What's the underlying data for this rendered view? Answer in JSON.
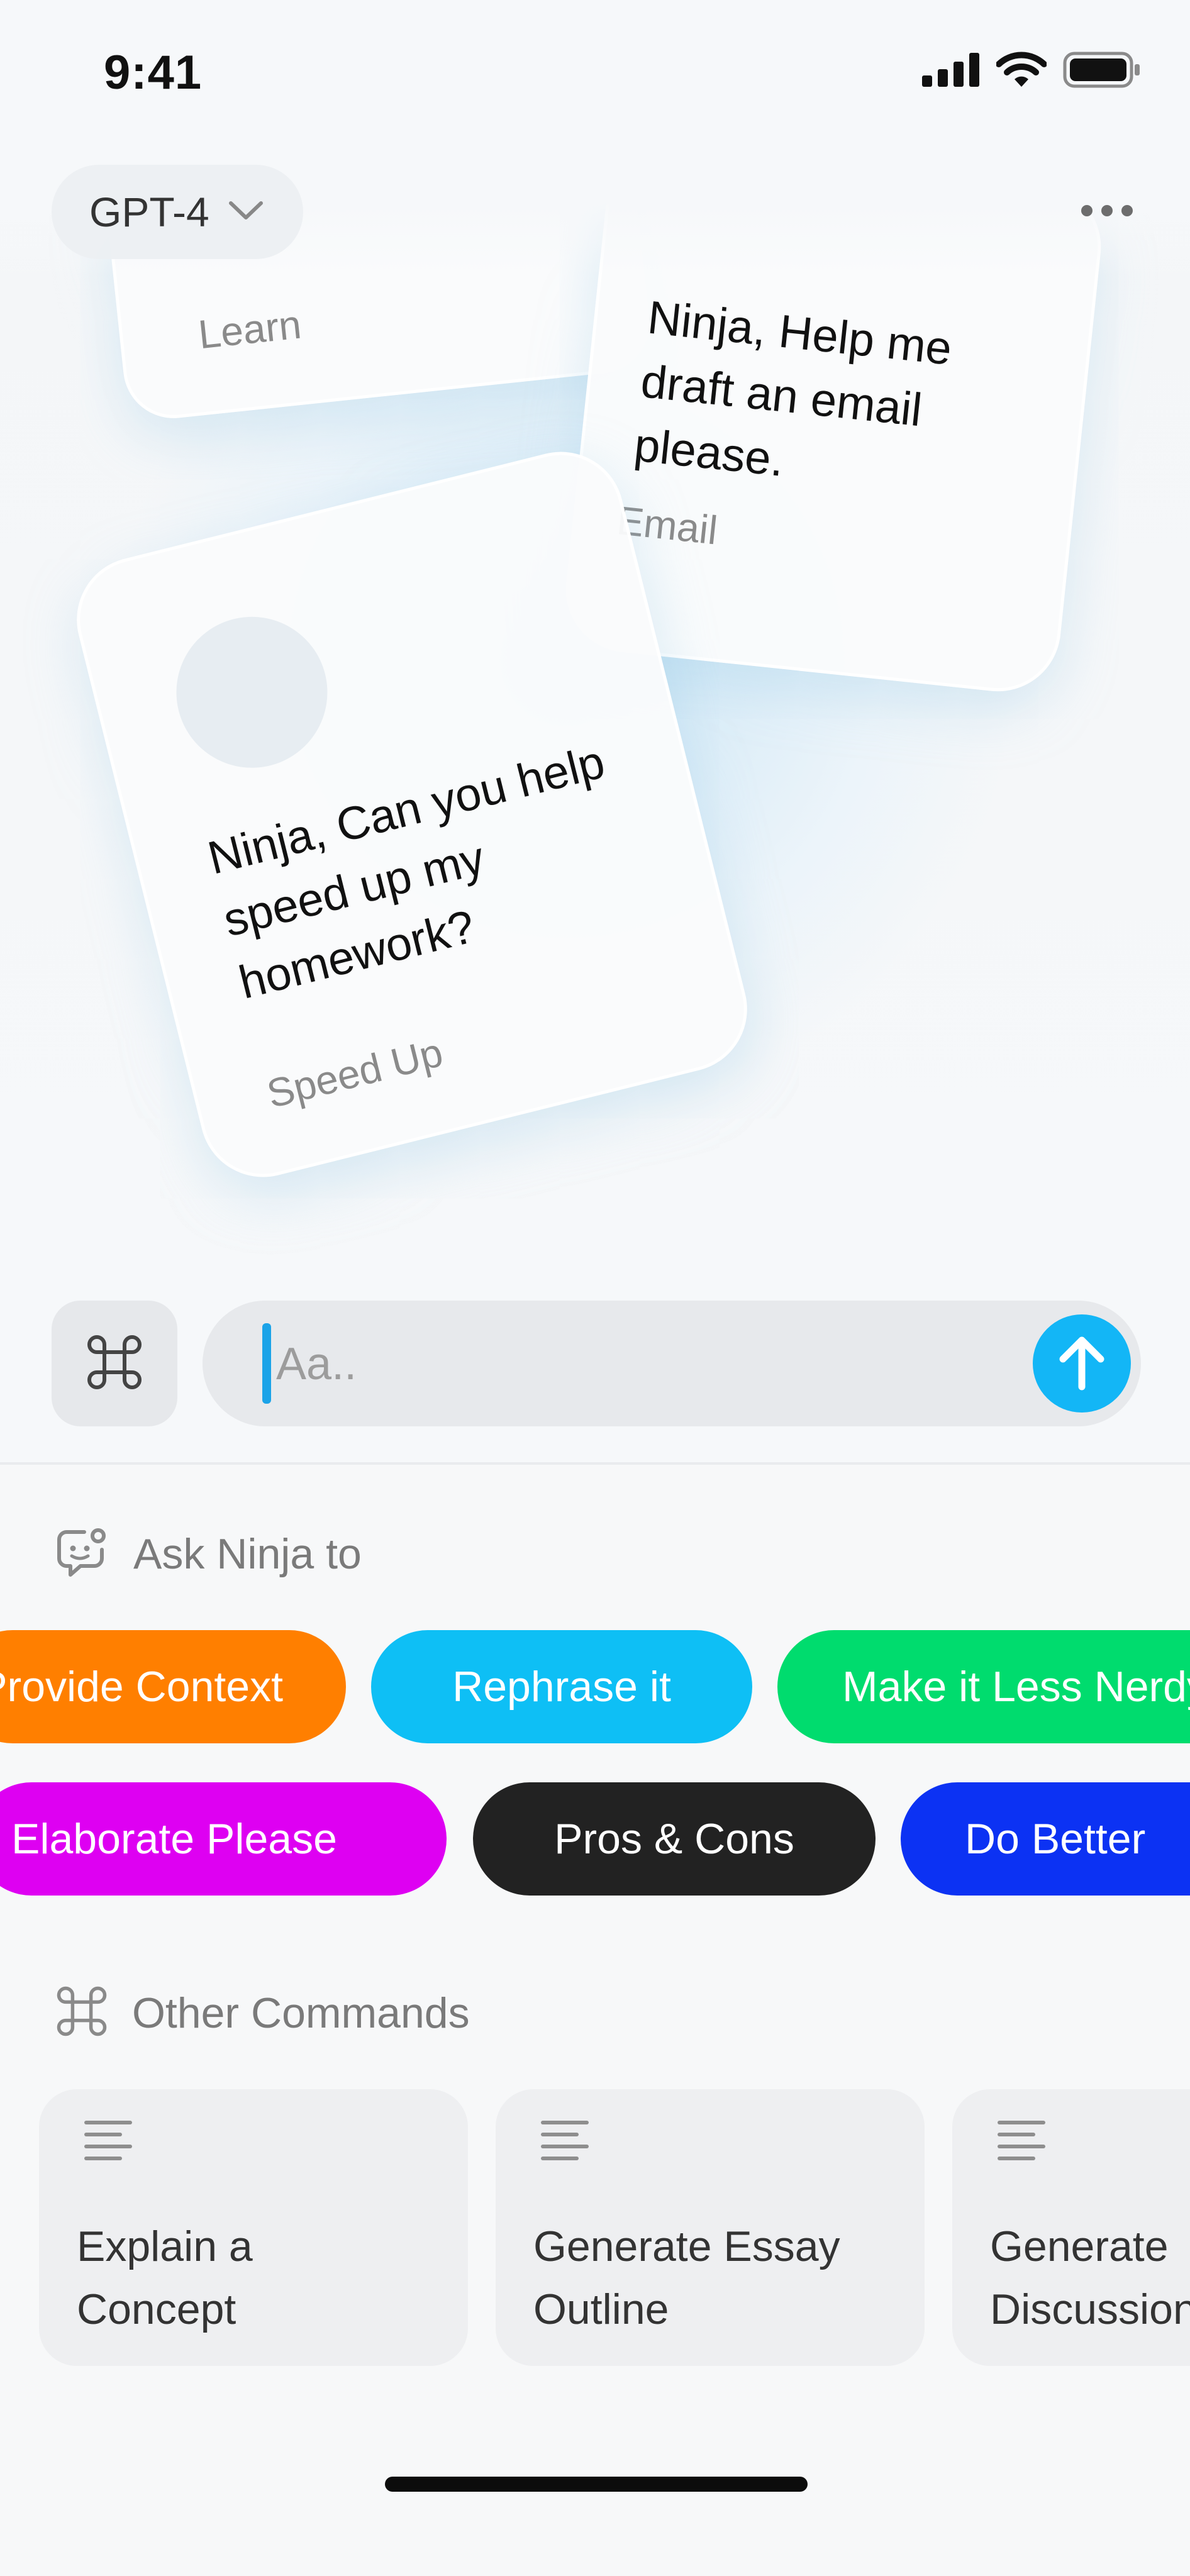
{
  "status_bar": {
    "time": "9:41"
  },
  "header": {
    "model": "GPT-4"
  },
  "cards": [
    {
      "tag": "Learn"
    },
    {
      "text": "Ninja, Help me draft an email please.",
      "tag": "Email"
    },
    {
      "text": "Ninja, Can you help speed up my homework?",
      "tag": "Speed Up"
    }
  ],
  "composer": {
    "placeholder": "Aa.."
  },
  "ask_section": {
    "title": "Ask Ninja to",
    "chips_row1": [
      {
        "label": "Provide Context",
        "color": "#ff7f00"
      },
      {
        "label": "Rephrase it",
        "color": "#0ebff5"
      },
      {
        "label": "Make it Less Nerdy",
        "color": "#00dc6e"
      }
    ],
    "chips_row2": [
      {
        "label": "Elaborate Please",
        "color": "#de00f2"
      },
      {
        "label": "Pros & Cons",
        "color": "#222222"
      },
      {
        "label": "Do Better",
        "color": "#0c32f3"
      }
    ]
  },
  "commands_section": {
    "title": "Other Commands",
    "cards": [
      {
        "label": "Explain a\nConcept"
      },
      {
        "label": "Generate Essay\nOutline"
      },
      {
        "label": "Generate\nDiscussion"
      }
    ]
  },
  "icons": [
    "signal-icon",
    "wifi-icon",
    "battery-icon",
    "chevron-down-icon",
    "more-icon",
    "command-icon",
    "arrow-up-icon",
    "chat-bot-icon",
    "text-lines-icon"
  ]
}
